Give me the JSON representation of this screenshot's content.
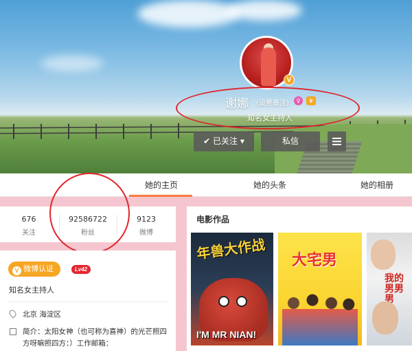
{
  "profile": {
    "name": "谢娜",
    "remark_label": "(设置备注)",
    "intro": "知名女主持人",
    "verified_badge": "V"
  },
  "actions": {
    "follow_label": "已关注",
    "follow_check": "✔",
    "follow_caret": "▾",
    "message_label": "私信"
  },
  "tabs": [
    "她的主页",
    "她的头条",
    "她的相册"
  ],
  "stats": [
    {
      "value": "676",
      "label": "关注"
    },
    {
      "value": "92586722",
      "label": "粉丝"
    },
    {
      "value": "9123",
      "label": "微博"
    }
  ],
  "info": {
    "verify_label": "微博认证",
    "verify_icon": "V",
    "level": "Lv42",
    "title": "知名女主持人",
    "location": "北京 海淀区",
    "bio": "简介：太阳女神（也可称为喜神）的光芒照四方呀嘛照四方：）工作邮箱："
  },
  "movies": {
    "section_title": "电影作品",
    "posters": [
      {
        "title": "年兽大作战",
        "subtitle": "I'M MR NIAN!"
      },
      {
        "title": "大宅男"
      },
      {
        "title": "我的男男男"
      }
    ]
  },
  "colors": {
    "page_bg": "#f5c6cf",
    "accent_orange": "#f77c3d",
    "verify_gold": "#f5a623",
    "level_red": "#e5262f",
    "annotation_red": "#e0252b"
  }
}
